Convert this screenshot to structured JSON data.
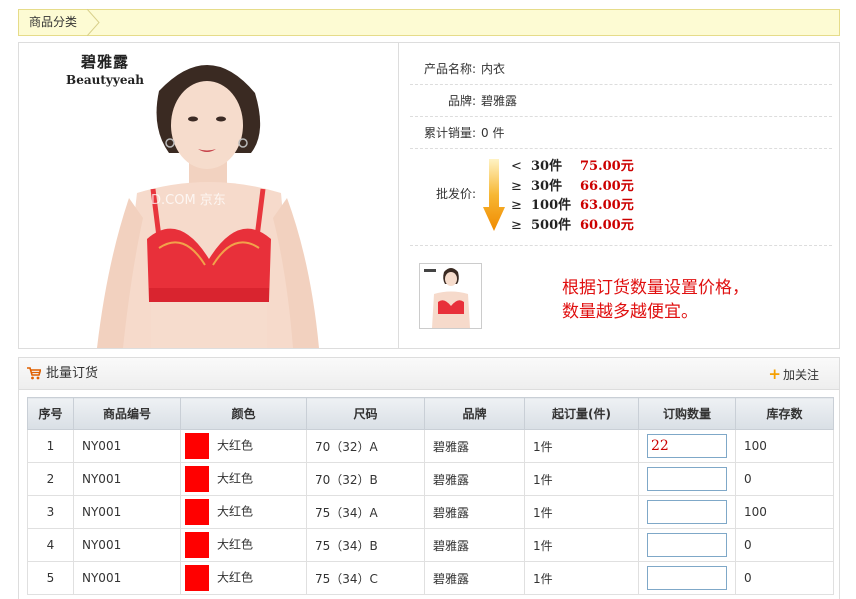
{
  "breadcrumb": {
    "label": "商品分类"
  },
  "brand_logo": {
    "cn": "碧雅露",
    "en": "Beautyyeah"
  },
  "watermark": "D.COM 京东",
  "product": {
    "name_label": "产品名称:",
    "name_value": "内衣",
    "brand_label": "品牌:",
    "brand_value": "碧雅露",
    "sales_label": "累计销量:",
    "sales_value": "0 件",
    "wholesale_label": "批发价:",
    "price_tiers": [
      {
        "op": "<",
        "qty": "30件",
        "price": "75.00元"
      },
      {
        "op": "≥",
        "qty": "30件",
        "price": "66.00元"
      },
      {
        "op": "≥",
        "qty": "100件",
        "price": "63.00元"
      },
      {
        "op": "≥",
        "qty": "500件",
        "price": "60.00元"
      }
    ]
  },
  "note": {
    "line1": "根据订货数量设置价格，",
    "line2": "数量越多越便宜。"
  },
  "order": {
    "title": "批量订货",
    "follow_label": "加关注",
    "columns": [
      "序号",
      "商品编号",
      "颜色",
      "尺码",
      "品牌",
      "起订量(件)",
      "订购数量",
      "库存数"
    ],
    "rows": [
      {
        "no": "1",
        "code": "NY001",
        "color": "大红色",
        "size": "70（32）A",
        "brand": "碧雅露",
        "moq": "1件",
        "qty": "22",
        "stock": "100"
      },
      {
        "no": "2",
        "code": "NY001",
        "color": "大红色",
        "size": "70（32）B",
        "brand": "碧雅露",
        "moq": "1件",
        "qty": "",
        "stock": "0"
      },
      {
        "no": "3",
        "code": "NY001",
        "color": "大红色",
        "size": "75（34）A",
        "brand": "碧雅露",
        "moq": "1件",
        "qty": "",
        "stock": "100"
      },
      {
        "no": "4",
        "code": "NY001",
        "color": "大红色",
        "size": "75（34）B",
        "brand": "碧雅露",
        "moq": "1件",
        "qty": "",
        "stock": "0"
      },
      {
        "no": "5",
        "code": "NY001",
        "color": "大红色",
        "size": "75（34）C",
        "brand": "碧雅露",
        "moq": "1件",
        "qty": "",
        "stock": "0"
      }
    ]
  },
  "colors": {
    "accent_red": "#cc0000",
    "swatch": "#ff0000",
    "arrow": "#f5a000"
  }
}
